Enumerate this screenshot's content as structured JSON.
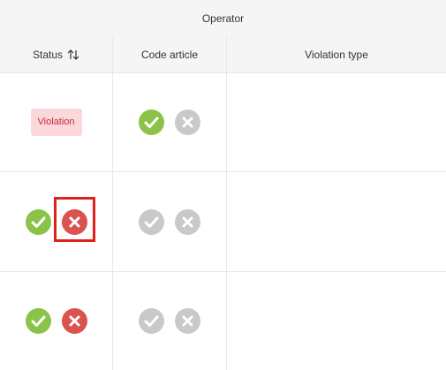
{
  "group_header": {
    "label": "Operator"
  },
  "columns": {
    "status": "Status",
    "code_article": "Code article",
    "violation_type": "Violation type"
  },
  "icons": {
    "sort": "sort-arrows-icon",
    "approve": "check-circle-icon",
    "reject": "x-circle-icon"
  },
  "colors": {
    "approve_active": "#8bc34a",
    "reject_active": "#d9534f",
    "inactive": "#c9c9c9",
    "badge_bg": "#fcd7dc",
    "badge_text": "#c42b3a",
    "highlight": "#e01f1f"
  },
  "rows": [
    {
      "status": {
        "badge": "Violation"
      },
      "code_article": {
        "approve": "active",
        "reject": "inactive"
      },
      "violation_type": ""
    },
    {
      "status": {
        "approve": "active",
        "reject": "active"
      },
      "code_article": {
        "approve": "inactive",
        "reject": "inactive"
      },
      "violation_type": ""
    },
    {
      "status": {
        "approve": "active",
        "reject": "active"
      },
      "code_article": {
        "approve": "inactive",
        "reject": "inactive"
      },
      "violation_type": ""
    }
  ]
}
